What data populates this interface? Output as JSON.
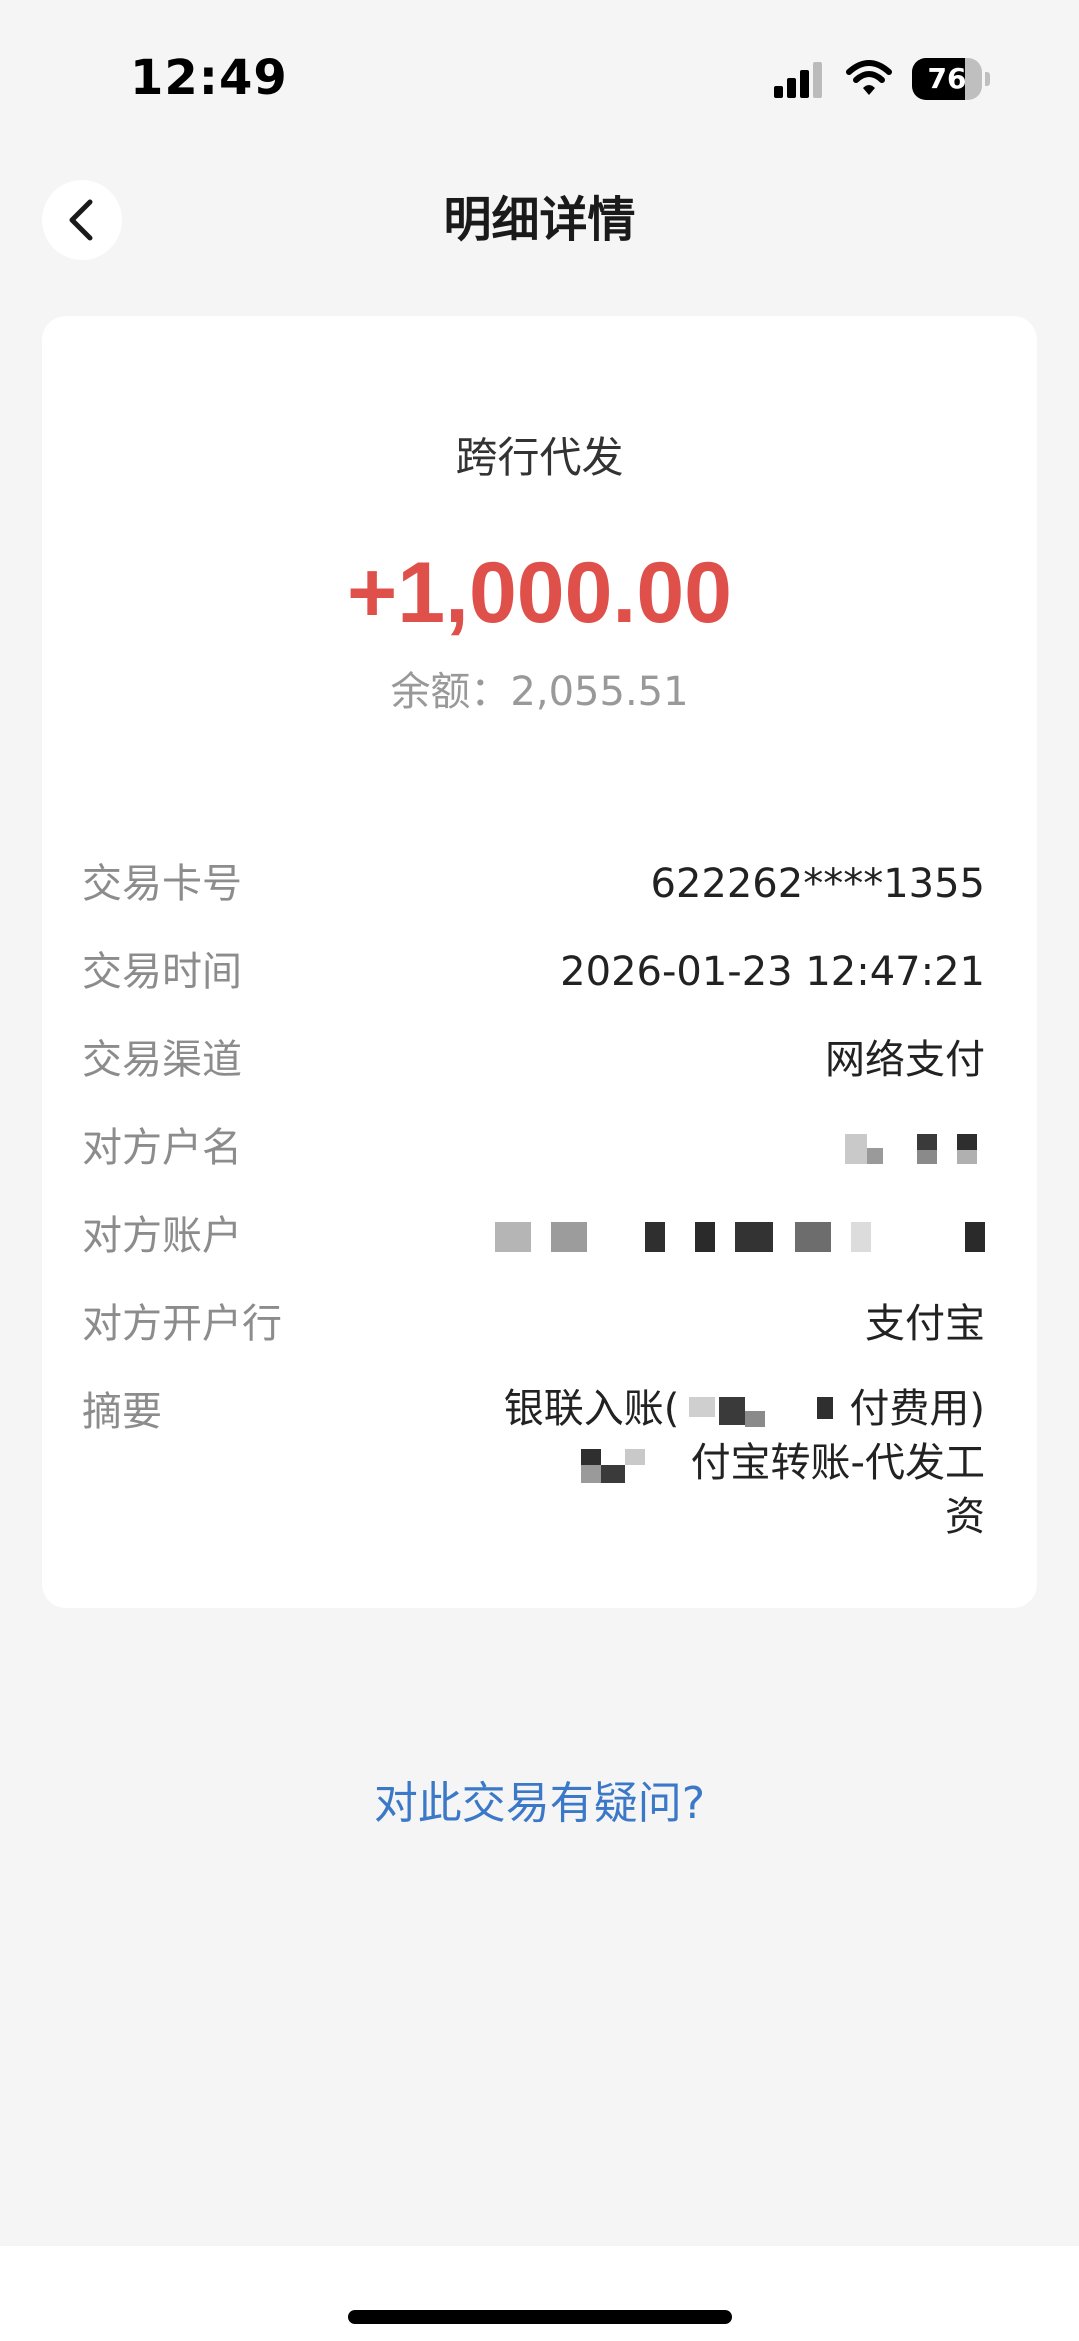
{
  "status_bar": {
    "time": "12:49",
    "battery_level": "76",
    "battery_fraction": 0.76
  },
  "nav": {
    "title": "明细详情"
  },
  "transaction": {
    "type": "跨行代发",
    "amount": "+1,000.00",
    "balance": "余额：2,055.51",
    "amount_color": "#e0504b"
  },
  "details": [
    {
      "label": "交易卡号",
      "value": "622262****1355"
    },
    {
      "label": "交易时间",
      "value": "2026-01-23 12:47:21"
    },
    {
      "label": "交易渠道",
      "value": "网络支付"
    },
    {
      "label": "对方户名",
      "value": ""
    },
    {
      "label": "对方账户",
      "value": ""
    },
    {
      "label": "对方开户行",
      "value": "支付宝"
    },
    {
      "label": "摘要",
      "value_lines": [
        "银联入账(",
        "付费用)",
        "付宝转账-代发工",
        "资"
      ]
    }
  ],
  "footer": {
    "question_link": "对此交易有疑问?",
    "link_color": "#3c78c8"
  }
}
